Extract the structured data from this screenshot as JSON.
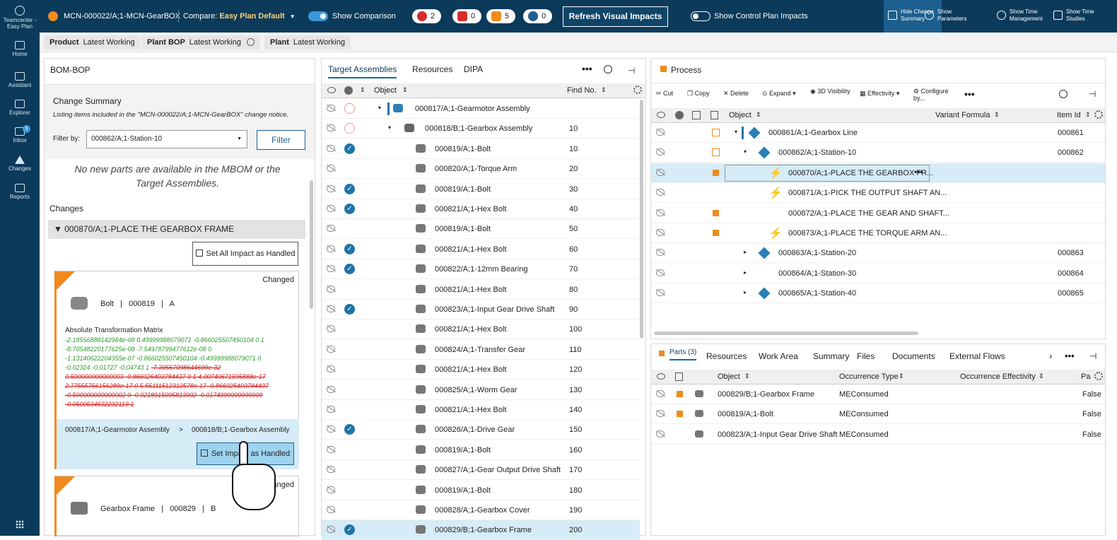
{
  "leftnav": {
    "app": "Teamcenter - Easy Plan",
    "items": [
      "Home",
      "Assistant",
      "Explorer",
      "Inbox",
      "Changes",
      "Reports"
    ],
    "inbox_badge": "5"
  },
  "topbar": {
    "notice": "MCN-000022/A;1-MCN-GearBOX",
    "compare_label": "Compare:",
    "compare_value": "Easy Plan Default",
    "show_comparison": "Show Comparison",
    "badges": [
      "2",
      "0",
      "5",
      "0"
    ],
    "refresh": "Refresh Visual Impacts",
    "show_control": "Show Control Plan Impacts",
    "right": [
      {
        "l1": "Hide Change",
        "l2": "Summary"
      },
      {
        "l1": "Show",
        "l2": "Parameters"
      },
      {
        "l1": "Show Time",
        "l2": "Management"
      },
      {
        "l1": "Show Time",
        "l2": "Studies"
      }
    ]
  },
  "context": [
    {
      "k": "Product",
      "v": "Latest Working"
    },
    {
      "k": "Plant BOP",
      "v": "Latest Working"
    },
    {
      "k": "Plant",
      "v": "Latest Working"
    }
  ],
  "bombop": {
    "title": "BOM-BOP",
    "cs_title": "Change Summary",
    "cs_desc": "Listing items included in the \"MCN-000022/A;1-MCN-GearBOX\" change notice.",
    "filter_label": "Filter by:",
    "filter_value": "000862/A;1-Station-10",
    "filter_btn": "Filter",
    "no_parts": "No new parts are available in the MBOM or the Target Assemblies.",
    "changes": "Changes",
    "group": "▼ 000870/A;1-PLACE THE GEARBOX FRAME",
    "set_all": "Set All Impact as Handled",
    "card1": {
      "status": "Changed",
      "name": "Bolt   |   000819   |   A",
      "matrix_title": "Absolute Transformation Matrix",
      "green": [
        "-2.18556888142984e-08 0.49999988079071 -0.866025507450104 0 1",
        "-8.70548220177625e-08 -7.54978799477612e-08 0",
        "-1.13140622204355e-07 -0.866025507450104 -0.49999988079071 0",
        "-0.02324 -0.01727 -0.04743 1"
      ],
      "red_inline": "-7.39557098644699e-32",
      "red": [
        "0.500000000000003 -0.866025403784437 0 1 4.00740671595888e-17",
        "2.77555756156289e-17 0 5.55111512312578e-17 -0.866025403784437",
        "-0.500000000000002 0 -0.0218915095813902 -0.0174999999999999",
        "-0.0500534632232113 1"
      ],
      "path_a": "000817/A;1-Gearmotor Assembly",
      "path_b": "000818/B;1-Gearbox Assembly",
      "handled": "Set Impact as Handled"
    },
    "card2": {
      "status": "Changed",
      "name": "Gearbox Frame   |   000829   |   B"
    }
  },
  "target": {
    "tabs": [
      "Target Assemblies",
      "Resources",
      "DIPA"
    ],
    "col_object": "Object",
    "col_find": "Find No.",
    "rows": [
      {
        "obj": "000817/A;1-Gearmotor Assembly",
        "find": "",
        "mark": "warn"
      },
      {
        "obj": "000818/B;1-Gearbox Assembly",
        "find": "10",
        "mark": "warn"
      },
      {
        "obj": "000819/A;1-Bolt",
        "find": "10",
        "mark": "chk"
      },
      {
        "obj": "000820/A;1-Torque Arm",
        "find": "20",
        "mark": ""
      },
      {
        "obj": "000819/A;1-Bolt",
        "find": "30",
        "mark": "chk"
      },
      {
        "obj": "000821/A;1-Hex Bolt",
        "find": "40",
        "mark": "chk"
      },
      {
        "obj": "000819/A;1-Bolt",
        "find": "50",
        "mark": ""
      },
      {
        "obj": "000821/A;1-Hex Bolt",
        "find": "60",
        "mark": "chk"
      },
      {
        "obj": "000822/A;1-12mm Bearing",
        "find": "70",
        "mark": "chk"
      },
      {
        "obj": "000821/A;1-Hex Bolt",
        "find": "80",
        "mark": ""
      },
      {
        "obj": "000823/A;1-Input Gear Drive Shaft",
        "find": "90",
        "mark": "chk"
      },
      {
        "obj": "000821/A;1-Hex Bolt",
        "find": "100",
        "mark": ""
      },
      {
        "obj": "000824/A;1-Transfer Gear",
        "find": "110",
        "mark": ""
      },
      {
        "obj": "000821/A;1-Hex Bolt",
        "find": "120",
        "mark": ""
      },
      {
        "obj": "000825/A;1-Worm Gear",
        "find": "130",
        "mark": ""
      },
      {
        "obj": "000821/A;1-Hex Bolt",
        "find": "140",
        "mark": ""
      },
      {
        "obj": "000826/A;1-Drive Gear",
        "find": "150",
        "mark": "chk"
      },
      {
        "obj": "000819/A;1-Bolt",
        "find": "160",
        "mark": ""
      },
      {
        "obj": "000827/A;1-Gear Output Drive Shaft",
        "find": "170",
        "mark": ""
      },
      {
        "obj": "000819/A;1-Bolt",
        "find": "180",
        "mark": ""
      },
      {
        "obj": "000828/A;1-Gearbox Cover",
        "find": "190",
        "mark": ""
      },
      {
        "obj": "000829/B;1-Gearbox Frame",
        "find": "200",
        "mark": "chk"
      }
    ]
  },
  "process": {
    "title": "Process",
    "tools": [
      "Cut",
      "Copy",
      "Delete",
      "Expand",
      "3D Visibility",
      "Effectivity",
      "Configure by..."
    ],
    "col_object": "Object",
    "col_variant": "Variant Formula",
    "col_item": "Item Id",
    "rows": [
      {
        "obj": "000861/A;1-Gearbox Line",
        "item": "000861"
      },
      {
        "obj": "000862/A;1-Station-10",
        "item": "000862"
      },
      {
        "obj": "000870/A;1-PLACE THE GEARBOX FR...",
        "item": ""
      },
      {
        "obj": "000871/A;1-PICK THE OUTPUT SHAFT AN...",
        "item": ""
      },
      {
        "obj": "000872/A;1-PLACE THE GEAR AND SHAFT...",
        "item": ""
      },
      {
        "obj": "000873/A;1-PLACE THE TORQUE ARM AN...",
        "item": ""
      },
      {
        "obj": "000863/A;1-Station-20",
        "item": "000863"
      },
      {
        "obj": "000864/A;1-Station-30",
        "item": "000864"
      },
      {
        "obj": "000865/A;1-Station-40",
        "item": "000865"
      }
    ]
  },
  "parts": {
    "tabs": [
      "Parts (3)",
      "Resources",
      "Work Area",
      "Summary",
      "Files",
      "Documents",
      "External Flows"
    ],
    "col_object": "Object",
    "col_occ": "Occurrence Type",
    "col_eff": "Occurrence Effectivity",
    "col_pa": "Pa",
    "rows": [
      {
        "obj": "000829/B;1-Gearbox Frame",
        "occ": "MEConsumed",
        "pa": "False"
      },
      {
        "obj": "000819/A;1-Bolt",
        "occ": "MEConsumed",
        "pa": "False"
      },
      {
        "obj": "000823/A;1-Input Gear Drive Shaft",
        "occ": "MEConsumed",
        "pa": "False"
      }
    ]
  },
  "colors": {
    "navy": "#0c3a5a",
    "accent": "#1e74a8",
    "orange": "#f08a1c",
    "highlight": "#d6ecf7"
  }
}
